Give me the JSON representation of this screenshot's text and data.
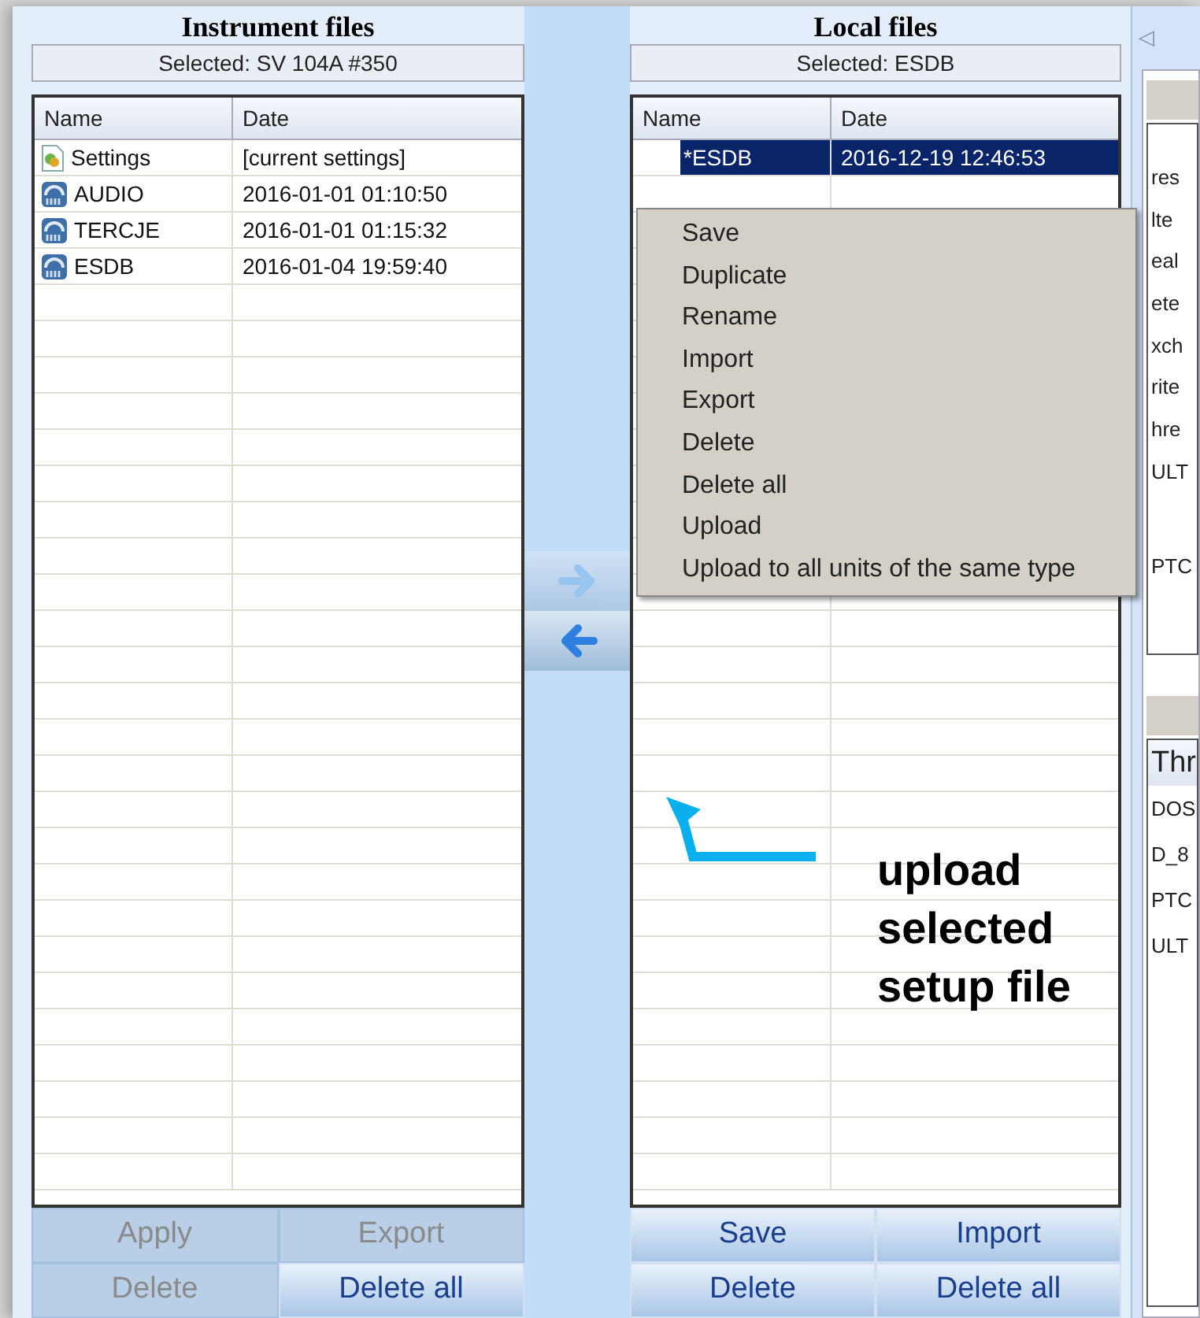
{
  "instrument_files": {
    "title": "Instrument files",
    "selected": "Selected: SV 104A #350",
    "columns": [
      "Name",
      "Date"
    ],
    "rows": [
      {
        "kind": "settings",
        "name": "Settings",
        "date": "[current settings]",
        "selected": false
      },
      {
        "kind": "setup",
        "name": "AUDIO",
        "date": "2016-01-01 01:10:50",
        "selected": false
      },
      {
        "kind": "setup",
        "name": "TERCJE",
        "date": "2016-01-01 01:15:32",
        "selected": false
      },
      {
        "kind": "setup",
        "name": "ESDB",
        "date": "2016-01-04 19:59:40",
        "selected": false
      }
    ],
    "buttons": [
      {
        "label": "Apply",
        "disabled": true
      },
      {
        "label": "Export",
        "disabled": true
      },
      {
        "label": "Delete",
        "disabled": true
      },
      {
        "label": "Delete all",
        "disabled": false
      }
    ]
  },
  "transfer_buttons": [
    {
      "kind": "right",
      "disabled": true
    },
    {
      "kind": "left",
      "disabled": false
    }
  ],
  "local_files": {
    "title": "Local files",
    "selected": "Selected: ESDB",
    "columns": [
      "Name",
      "Date"
    ],
    "rows": [
      {
        "name": "*ESDB",
        "date": "2016-12-19 12:46:53",
        "selected": true
      }
    ],
    "buttons": [
      {
        "label": "Save",
        "disabled": false
      },
      {
        "label": "Import",
        "disabled": false
      },
      {
        "label": "Delete",
        "disabled": false
      },
      {
        "label": "Delete all",
        "disabled": false
      }
    ]
  },
  "context_menu": [
    "Save",
    "Duplicate",
    "Rename",
    "Import",
    "Export",
    "Delete",
    "Delete all",
    "Upload",
    "Upload to all units of the same type"
  ],
  "right_panel": {
    "tab_arrow": "◁",
    "upper_rows": [
      "res",
      "lte",
      "eal",
      "ete",
      "xch",
      "rite",
      "hre",
      "ULT",
      "PTC"
    ],
    "lower_header": "Thr",
    "lower_rows": [
      "DOS",
      "D_8",
      "PTC",
      "ULT"
    ]
  },
  "annotation": {
    "text": "upload selected setup file"
  }
}
